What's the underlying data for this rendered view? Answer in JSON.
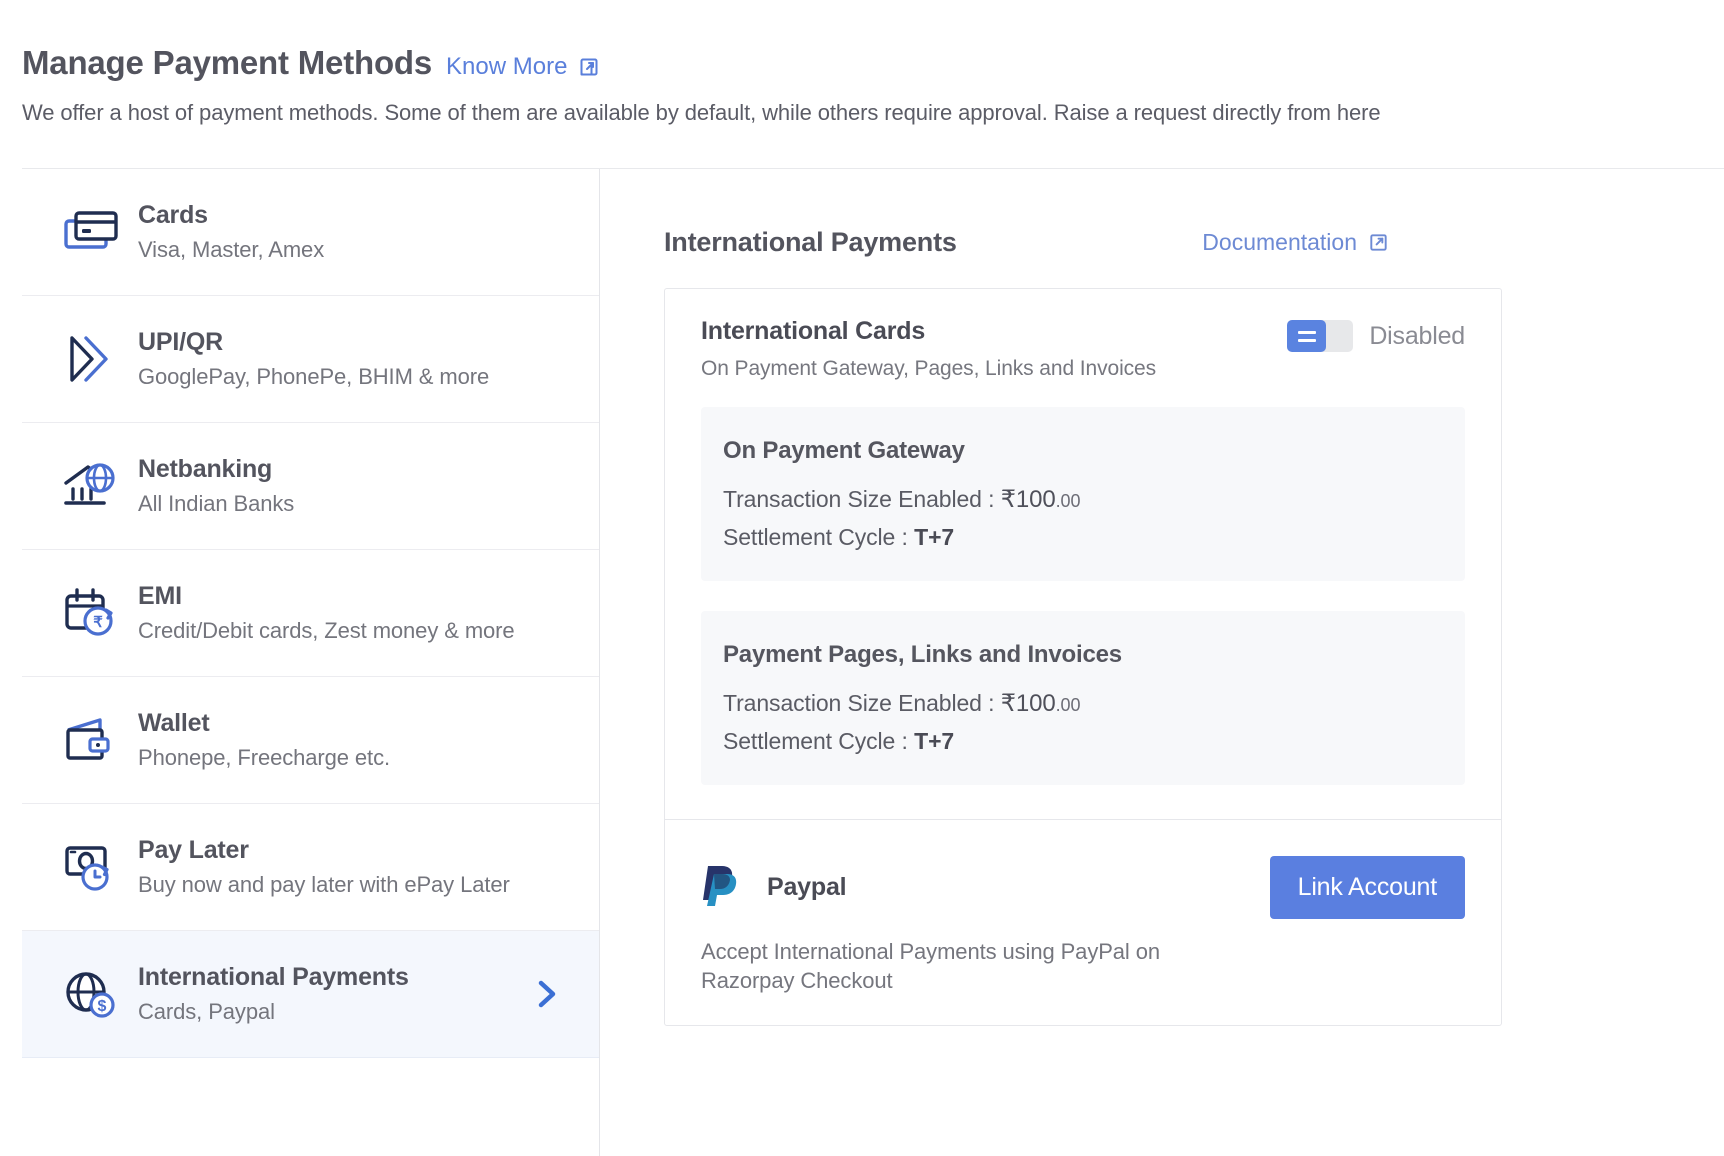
{
  "header": {
    "title": "Manage Payment Methods",
    "know_more": "Know More",
    "know_more_icon": "external-link-icon",
    "subtitle": "We offer a host of payment methods. Some of them are available by default, while others require approval. Raise a request directly from here"
  },
  "sidebar": {
    "items": [
      {
        "id": "cards",
        "icon": "credit-card-icon",
        "title": "Cards",
        "sub": "Visa, Master, Amex",
        "selected": false
      },
      {
        "id": "upi-qr",
        "icon": "upi-chevrons-icon",
        "title": "UPI/QR",
        "sub": "GooglePay, PhonePe, BHIM & more",
        "selected": false
      },
      {
        "id": "netbanking",
        "icon": "bank-globe-icon",
        "title": "Netbanking",
        "sub": "All Indian Banks",
        "selected": false
      },
      {
        "id": "emi",
        "icon": "calendar-rupee-icon",
        "title": "EMI",
        "sub": "Credit/Debit cards, Zest money & more",
        "selected": false
      },
      {
        "id": "wallet",
        "icon": "wallet-icon",
        "title": "Wallet",
        "sub": "Phonepe, Freecharge etc.",
        "selected": false
      },
      {
        "id": "pay-later",
        "icon": "cash-clock-icon",
        "title": "Pay Later",
        "sub": "Buy now and pay later with ePay Later",
        "selected": false
      },
      {
        "id": "international-payments",
        "icon": "globe-dollar-icon",
        "title": "International Payments",
        "sub": "Cards, Paypal",
        "selected": true
      }
    ]
  },
  "detail": {
    "title": "International Payments",
    "documentation_label": "Documentation",
    "documentation_icon": "external-link-icon",
    "international_cards": {
      "title": "International Cards",
      "subtitle": "On Payment Gateway, Pages, Links and Invoices",
      "toggle_state": "Disabled",
      "toggle_on": false,
      "boxes": [
        {
          "title": "On Payment Gateway",
          "transaction_label": "Transaction Size Enabled :",
          "currency_symbol": "₹",
          "amount_major": "100",
          "amount_minor": ".00",
          "settlement_label": "Settlement Cycle :",
          "settlement_value": "T+7"
        },
        {
          "title": "Payment Pages, Links and Invoices",
          "transaction_label": "Transaction Size Enabled :",
          "currency_symbol": "₹",
          "amount_major": "100",
          "amount_minor": ".00",
          "settlement_label": "Settlement Cycle :",
          "settlement_value": "T+7"
        }
      ]
    },
    "paypal": {
      "icon": "paypal-logo-icon",
      "name": "Paypal",
      "description": "Accept International Payments using PayPal on Razorpay Checkout",
      "button_label": "Link Account"
    }
  },
  "colors": {
    "link_blue": "#5a7fdb",
    "doc_blue": "#6d8ad4",
    "button_blue": "#5a7fe0",
    "toggle_blue": "#5a83e0",
    "icon_dark": "#1f2d50",
    "icon_accent": "#4a6fd0",
    "chevron_blue": "#3b6fd4",
    "selected_row_bg": "#f4f7fd",
    "info_box_bg": "#f7f8fa",
    "title_gray": "#53545e",
    "sub_gray": "#74757d"
  }
}
